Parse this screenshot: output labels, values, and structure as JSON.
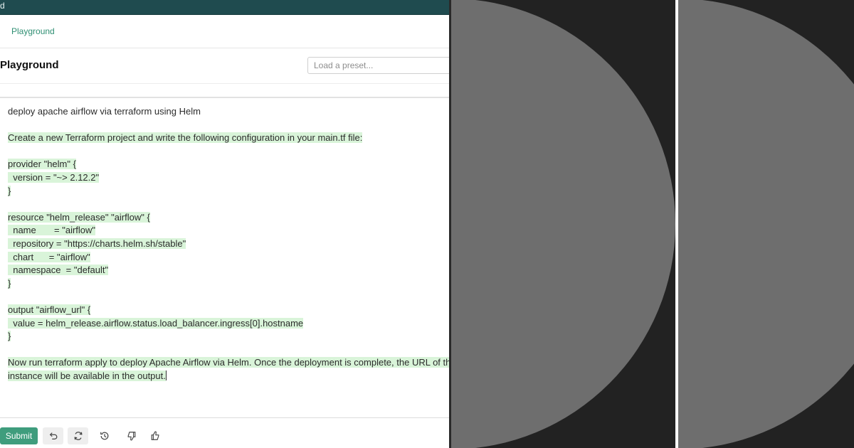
{
  "window": {
    "brand_fragment": "d"
  },
  "breadcrumb": {
    "label": "Playground"
  },
  "header": {
    "title": "Playground",
    "preset_placeholder": "Load a preset..."
  },
  "editor": {
    "prompt": "deploy apache airflow via terraform using Helm",
    "completion": "Create a new Terraform project and write the following configuration in your main.tf file:\n\nprovider \"helm\" {\n  version = \"~> 2.12.2\"\n}\n\nresource \"helm_release\" \"airflow\" {\n  name       = \"airflow\"\n  repository = \"https://charts.helm.sh/stable\"\n  chart      = \"airflow\"\n  namespace  = \"default\"\n}\n\noutput \"airflow_url\" {\n  value = helm_release.airflow.status.load_balancer.ingress[0].hostname\n}\n\nNow run terraform apply to deploy Apache Airflow via Helm. Once the deployment is complete, the URL of the\ninstance will be available in the output."
  },
  "actions": {
    "submit_label": "Submit",
    "icons": [
      "undo-icon",
      "regenerate-icon",
      "history-icon",
      "thumbs-down-icon",
      "thumbs-up-icon"
    ]
  },
  "colors": {
    "topbar": "#1f4b4f",
    "accent": "#3f9d7d",
    "highlight": "#d9f4d9",
    "panel_bg": "#222222",
    "circle": "#6e6e6e"
  }
}
